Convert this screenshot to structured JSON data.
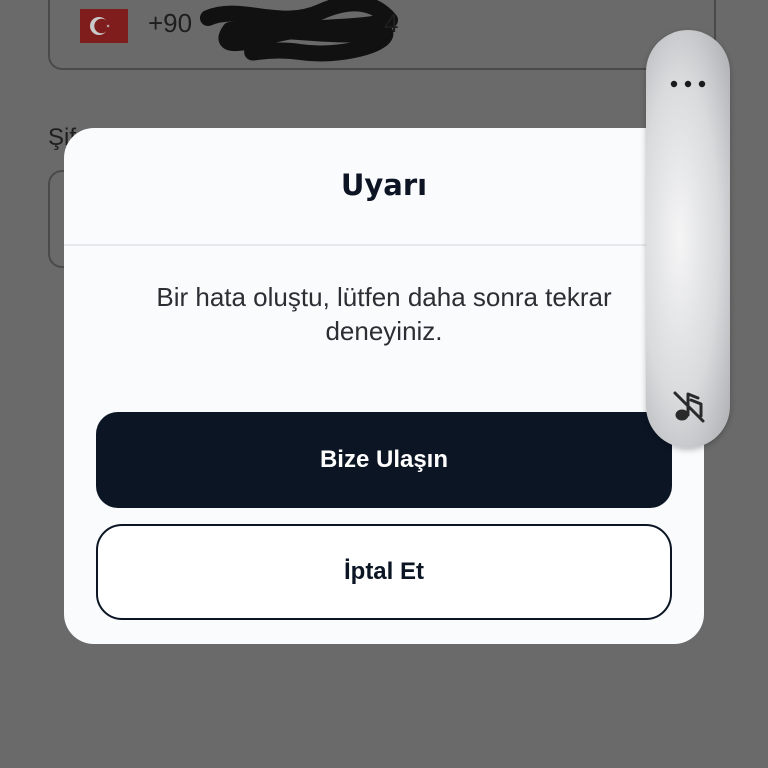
{
  "background": {
    "phone": {
      "flag_icon": "turkey-flag-icon",
      "country_code": "+90",
      "trailing_digit": "4"
    },
    "password_label": "Şif"
  },
  "dialog": {
    "title": "Uyarı",
    "message": "Bir hata oluştu, lütfen daha sonra tekrar deneyiniz.",
    "primary_button": "Bize Ulaşın",
    "secondary_button": "İptal Et"
  },
  "side_panel": {
    "more_icon": "more-horizontal-icon",
    "mute_icon": "music-off-icon"
  },
  "colors": {
    "overlay": "#6a6a6a",
    "dialog_bg": "#fafbfc",
    "primary": "#0b1524"
  }
}
